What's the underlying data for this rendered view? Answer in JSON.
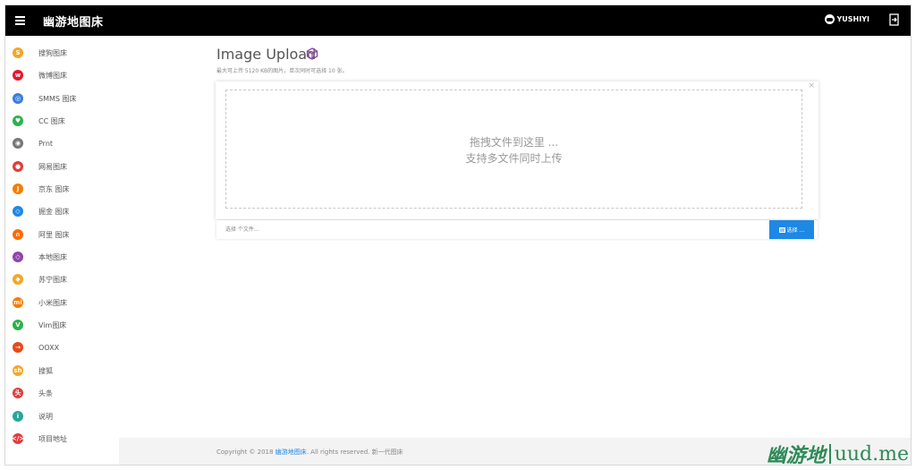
{
  "header": {
    "app_title": "幽游地图床",
    "username": "YUSHIYI"
  },
  "sidebar": {
    "items": [
      {
        "label": "搜狗图床",
        "icon": "sogou-icon",
        "color": "#f5a623"
      },
      {
        "label": "微博图床",
        "icon": "weibo-icon",
        "color": "#e6162d"
      },
      {
        "label": "SMMS 图床",
        "icon": "smms-icon",
        "color": "#3b7ddd"
      },
      {
        "label": "CC 图床",
        "icon": "cc-icon",
        "color": "#2bb24c"
      },
      {
        "label": "Prnt",
        "icon": "prnt-icon",
        "color": "#777777"
      },
      {
        "label": "网易图床",
        "icon": "netease-icon",
        "color": "#e23c3c"
      },
      {
        "label": "京东 图床",
        "icon": "jd-icon",
        "color": "#f57c00"
      },
      {
        "label": "掘金 图床",
        "icon": "juejin-icon",
        "color": "#1e88e5"
      },
      {
        "label": "阿里 图床",
        "icon": "ali-icon",
        "color": "#ff6a00"
      },
      {
        "label": "本地图床",
        "icon": "local-cube-icon",
        "color": "#8e44ad"
      },
      {
        "label": "苏宁图床",
        "icon": "suning-icon",
        "color": "#f5a623"
      },
      {
        "label": "小米图床",
        "icon": "xiaomi-icon",
        "color": "#f57c00"
      },
      {
        "label": "Vim图床",
        "icon": "vim-icon",
        "color": "#2bb24c"
      },
      {
        "label": "OOXX",
        "icon": "ooxx-icon",
        "color": "#e64a19"
      },
      {
        "label": "搜狐",
        "icon": "sohu-icon",
        "color": "#f5a623"
      },
      {
        "label": "头条",
        "icon": "toutiao-icon",
        "color": "#e23c3c"
      },
      {
        "label": "说明",
        "icon": "info-icon",
        "color": "#26a69a"
      },
      {
        "label": "项目地址",
        "icon": "code-icon",
        "color": "#e23c3c"
      }
    ]
  },
  "main": {
    "title": "Image Upload",
    "hint": "最大可上传 5120 KB的图片，单次同时可选择 10 张。",
    "dropzone_line1": "拖拽文件到这里 ...",
    "dropzone_line2": "支持多文件同时上传",
    "close_label": "×",
    "file_placeholder": "选择 个文件...",
    "choose_label": "选择 ..."
  },
  "footer": {
    "copyright_prefix": "Copyright © 2018",
    "copyright_link": "幽游地图床",
    "copyright_suffix": ". All rights reserved. 新一代图床"
  },
  "watermark": {
    "cn": "幽游地",
    "en": "uud.me"
  },
  "colors": {
    "topbar": "#000000",
    "accent": "#1e88e5",
    "cube": "#8e44ad"
  }
}
